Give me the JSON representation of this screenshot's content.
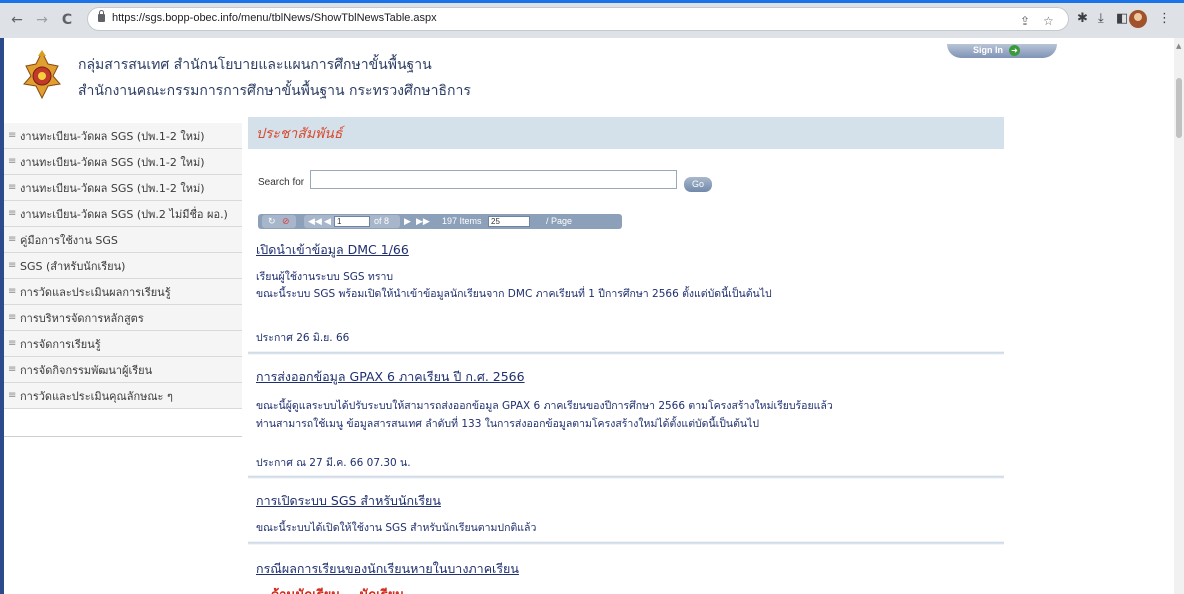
{
  "browser": {
    "url": "https://sgs.bopp-obec.info/menu/tblNews/ShowTblNewsTable.aspx",
    "back": "←",
    "forward": "→",
    "reload": "C",
    "share_icon": "share-icon",
    "bookmark_icon": "star-icon",
    "ext_icons": [
      "puzzle-icon",
      "download-icon",
      "sidebar-icon",
      "profile-avatar",
      "menu-icon"
    ]
  },
  "header": {
    "title_line1": "กลุ่มสารสนเทศ สำนักนโยบายและแผนการศึกษาขั้นพื้นฐาน",
    "title_line2": "สำนักงานคณะกรรมการการศึกษาขั้นพื้นฐาน กระทรวงศึกษาธิการ",
    "signin_label": "Sign In"
  },
  "menu": {
    "items": [
      "งานทะเบียน-วัดผล SGS (ปพ.1-2 ใหม่)",
      "งานทะเบียน-วัดผล SGS (ปพ.1-2 ใหม่)",
      "งานทะเบียน-วัดผล SGS (ปพ.1-2 ใหม่)",
      "งานทะเบียน-วัดผล SGS (ปพ.2 ไม่มีชื่อ ผอ.)",
      "คู่มือการใช้งาน SGS",
      "SGS (สำหรับนักเรียน)",
      "การวัดและประเมินผลการเรียนรู้",
      "การบริหารจัดการหลักสูตร",
      "การจัดการเรียนรู้",
      "การจัดกิจกรรมพัฒนาผู้เรียน",
      "การวัดและประเมินคุณลักษณะ ๆ"
    ]
  },
  "content": {
    "section_title": "ประชาสัมพันธ์",
    "search_label": "Search for",
    "search_value": "",
    "go_label": "Go",
    "pager": {
      "page_value": "1",
      "of_text": "of 8",
      "items_text": "197 Items",
      "page_size": "25",
      "per_page_text": "/ Page"
    },
    "news": [
      {
        "title": "เปิดนำเข้าข้อมูล DMC 1/66",
        "lines": [
          "เรียนผู้ใช้งานระบบ SGS ทราบ",
          "ขณะนี้ระบบ SGS พร้อมเปิดให้นำเข้าข้อมูลนักเรียนจาก DMC ภาคเรียนที่ 1 ปีการศึกษา 2566 ตั้งแต่บัดนี้เป็นต้นไป"
        ],
        "date": "ประกาศ 26 มิ.ย. 66"
      },
      {
        "title": "การส่งออกข้อมูล GPAX 6 ภาคเรียน ปี ก.ศ. 2566",
        "lines": [
          "ขณะนี้ผู้ดูแลระบบได้ปรับระบบให้สามารถส่งออกข้อมูล GPAX 6 ภาคเรียนของปีการศึกษา 2566 ตามโครงสร้างใหม่เรียบร้อยแล้ว",
          "ท่านสามารถใช้เมนู ข้อมูลสารสนเทศ ลำดับที่ 133 ในการส่งออกข้อมูลตามโครงสร้างใหม่ได้ตั้งแต่บัดนี้เป็นต้นไป"
        ],
        "date": "ประกาศ ณ 27 มี.ค. 66 07.30 น."
      },
      {
        "title": "การเปิดระบบ SGS สำหรับนักเรียน",
        "lines": [
          "ขณะนี้ระบบได้เปิดให้ใช้งาน SGS สำหรับนักเรียนตามปกติแล้ว"
        ],
        "date": ""
      },
      {
        "title": "กรณีผลการเรียนของนักเรียนหายในบางภาคเรียน",
        "lines": [],
        "date": ""
      }
    ],
    "partial_text": "...ด้านนักเรียน... นักเรียน... ..."
  },
  "colors": {
    "accent_red": "#d94a2e",
    "link_navy": "#1f2f6f",
    "section_bg": "#d4e0ea"
  }
}
